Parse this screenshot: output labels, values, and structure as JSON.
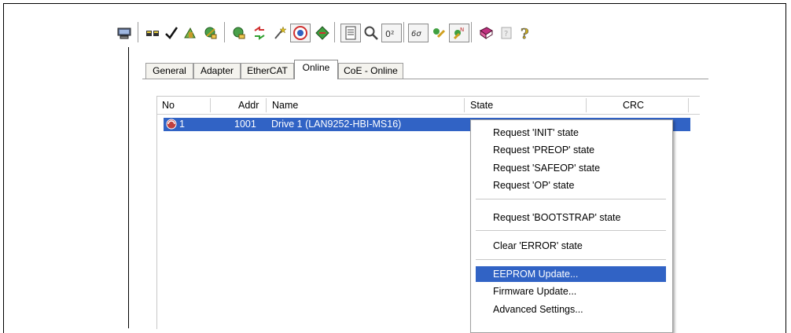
{
  "tabs": [
    {
      "label": "General"
    },
    {
      "label": "Adapter"
    },
    {
      "label": "EtherCAT"
    },
    {
      "label": "Online"
    },
    {
      "label": "CoE - Online"
    }
  ],
  "active_tab": "Online",
  "columns": [
    {
      "label": "No"
    },
    {
      "label": "Addr"
    },
    {
      "label": "Name"
    },
    {
      "label": "State"
    },
    {
      "label": "CRC"
    }
  ],
  "rows": [
    {
      "no": "1",
      "addr": "1001",
      "name": "Drive 1 (LAN9252-HBI-MS16)",
      "selected": true
    }
  ],
  "context_menu": {
    "items": [
      {
        "label": "Request 'INIT' state"
      },
      {
        "label": "Request 'PREOP' state"
      },
      {
        "label": "Request 'SAFEOP' state"
      },
      {
        "label": "Request 'OP' state"
      },
      {
        "label": "Request 'BOOTSTRAP' state"
      },
      {
        "label": "Clear 'ERROR' state"
      },
      {
        "label": "EEPROM Update..."
      },
      {
        "label": "Firmware Update..."
      },
      {
        "label": "Advanced Settings..."
      }
    ],
    "highlighted": "EEPROM Update..."
  },
  "toolbar_icons": [
    "computer-icon",
    "devices-icon",
    "check-icon",
    "build-icon",
    "network-scan-icon",
    "search-devices-icon",
    "transfer-icon",
    "wizard-icon",
    "target-icon",
    "route-icon",
    "document-icon",
    "magnifier-icon",
    "variables-icon",
    "glasses-icon",
    "config-icon",
    "axis-icon",
    "book-icon",
    "help-book-icon",
    "help-icon"
  ],
  "colors": {
    "selection": "#3163c5",
    "tab_bg": "#f4f3ee"
  }
}
